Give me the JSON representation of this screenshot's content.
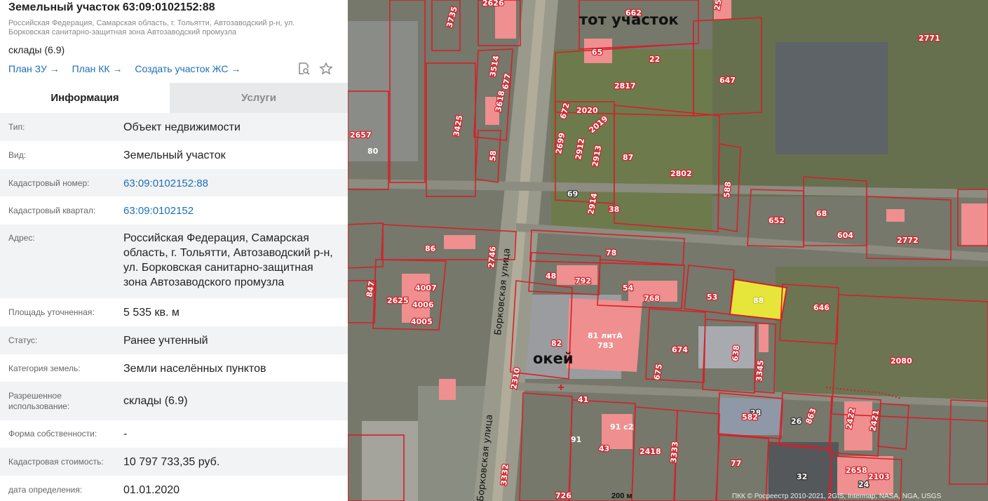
{
  "panel": {
    "title": "Земельный участок 63:09:0102152:88",
    "subtitle": "Российская Федерация, Самарская область, г. Тольятти, Автозаводский р-н, ул. Борковская санитарно-защитная зона Автозаводский промузла",
    "usage": "склады (6.9)",
    "links": [
      "План ЗУ →",
      "План КК →",
      "Создать участок ЖС →"
    ],
    "icons": [
      "search-document-icon",
      "star-icon"
    ],
    "tabs": [
      "Информация",
      "Услуги"
    ],
    "rows": [
      {
        "label": "Тип:",
        "value": "Объект недвижимости"
      },
      {
        "label": "Вид:",
        "value": "Земельный участок"
      },
      {
        "label": "Кадастровый номер:",
        "value": "63:09:0102152:88",
        "link": true
      },
      {
        "label": "Кадастровый квартал:",
        "value": "63:09:0102152",
        "link": true
      },
      {
        "label": "Адрес:",
        "value": "Российская Федерация, Самарская область, г. Тольятти, Автозаводский р-н, ул. Борковская санитарно-защитная зона Автозаводского промузла"
      },
      {
        "label": "Площадь уточненная:",
        "value": "5 535 кв. м"
      },
      {
        "label": "Статус:",
        "value": "Ранее учтенный"
      },
      {
        "label": "Категория земель:",
        "value": "Земли населённых пунктов"
      },
      {
        "label": "Разрешенное использование:",
        "value": "склады (6.9)"
      },
      {
        "label": "Форма собственности:",
        "value": "-"
      },
      {
        "label": "Кадастровая стоимость:",
        "value": "10 797 733,35 руб."
      },
      {
        "label": "дата определения:",
        "value": "01.01.2020"
      }
    ]
  },
  "map": {
    "annotations": [
      "тот участок",
      "окей"
    ],
    "streets": [
      "Борковская улица",
      "Борковская улица"
    ],
    "parcel_labels": [
      "662",
      "2626",
      "3735",
      "25",
      "2771",
      "65",
      "22",
      "2817",
      "647",
      "3514",
      "677",
      "3618",
      "2020",
      "672",
      "2019",
      "3425",
      "2657",
      "80",
      "2699",
      "2912",
      "2913",
      "87",
      "2802",
      "588",
      "58",
      "69",
      "2914",
      "38",
      "652",
      "68",
      "604",
      "2772",
      "86",
      "2746",
      "78",
      "48",
      "792",
      "54",
      "768",
      "53",
      "88",
      "646",
      "847",
      "2625",
      "4007",
      "4006",
      "4005",
      "82",
      "81 литА",
      "783",
      "674",
      "638",
      "3345",
      "2080",
      "2310",
      "675",
      "41",
      "28",
      "582",
      "26",
      "863",
      "2422",
      "2421",
      "91 с2",
      "91",
      "43",
      "2418",
      "3333",
      "77",
      "32",
      "2658",
      "2103",
      "24",
      "3332",
      "726"
    ],
    "selected_parcel": "88",
    "scale": "200 м",
    "attribution": "ПКК © Росреестр 2010-2021, 2GIS, Intermap, NASA, NGA, USGS",
    "colors": {
      "boundary": "#d4202a",
      "building": "#ef8f8f",
      "selected": "#e6e63a"
    }
  }
}
